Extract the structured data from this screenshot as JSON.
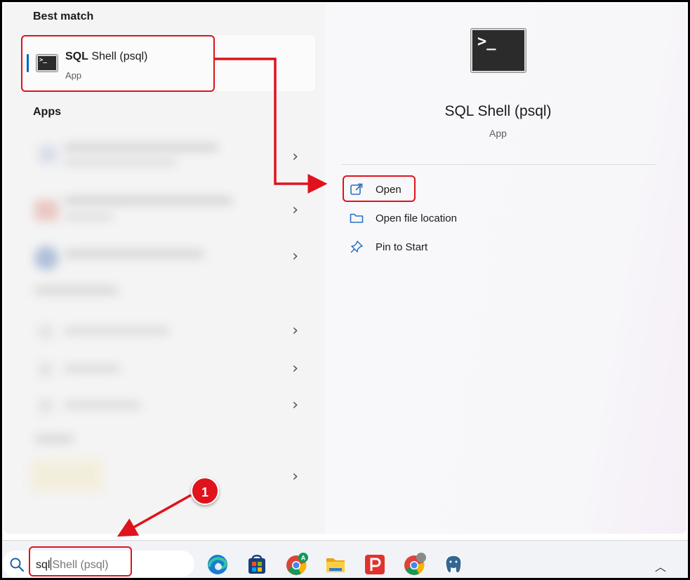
{
  "start_menu": {
    "best_match_heading": "Best match",
    "best_match": {
      "name_bold": "SQL",
      "name_rest": " Shell (psql)",
      "type": "App",
      "icon": "terminal-icon"
    },
    "apps_heading": "Apps"
  },
  "detail_pane": {
    "app_name": "SQL Shell (psql)",
    "app_type": "App",
    "actions": [
      {
        "label": "Open",
        "icon": "open-external-icon"
      },
      {
        "label": "Open file location",
        "icon": "folder-icon"
      },
      {
        "label": "Pin to Start",
        "icon": "pin-icon"
      }
    ]
  },
  "taskbar": {
    "search_typed": "sql",
    "search_suggestion": "Shell (psql)",
    "apps": [
      "edge-icon",
      "store-icon",
      "chrome-icon",
      "file-explorer-icon",
      "app-icon",
      "chrome-icon",
      "postgresql-icon"
    ]
  },
  "annotation": {
    "step_number": "1",
    "color": "#e0121c"
  }
}
